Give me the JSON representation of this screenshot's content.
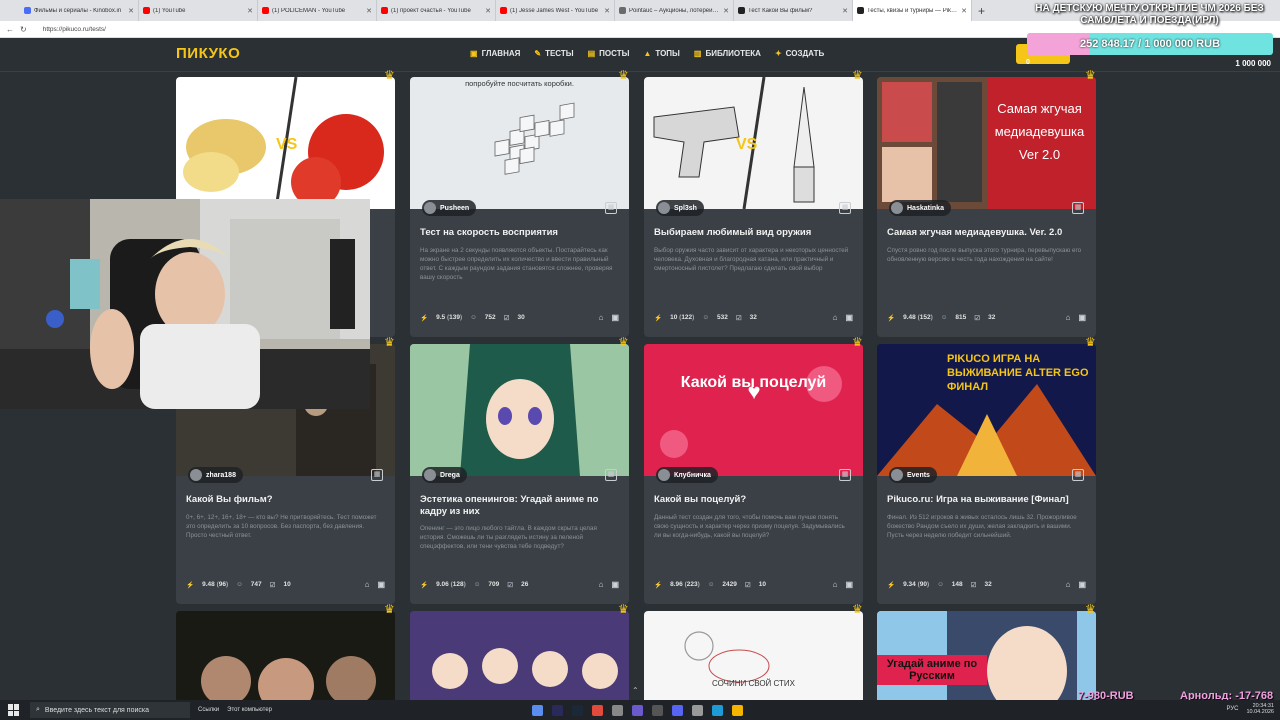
{
  "browser": {
    "tabs": [
      {
        "label": "Фильмы и сериалы - Kinobox.in",
        "color": "#4a6cf7",
        "active": false
      },
      {
        "label": "(1) YouTube",
        "color": "#ff0000",
        "active": false
      },
      {
        "label": "(1) POLICEMAN - YouTube",
        "color": "#ff0000",
        "active": false
      },
      {
        "label": "(1) проект счастья - YouTube",
        "color": "#ff0000",
        "active": false
      },
      {
        "label": "(1) Jesse James West - YouTube",
        "color": "#ff0000",
        "active": false
      },
      {
        "label": "Pointauc – Аукционы, лотереи и ...",
        "color": "#6b6b6b",
        "active": false
      },
      {
        "label": "Тест Какой Вы фильм?",
        "color": "#222222",
        "active": false
      },
      {
        "label": "Тесты, квизы и турниры — Piku...",
        "color": "#222222",
        "active": true
      }
    ],
    "new_tab": "+",
    "url": "https://pikuco.ru/tests/"
  },
  "site": {
    "logo": "ПИКУКО",
    "nav": [
      {
        "label": "ГЛАВНАЯ",
        "icon": "home-icon"
      },
      {
        "label": "ТЕСТЫ",
        "icon": "test-icon"
      },
      {
        "label": "ПОСТЫ",
        "icon": "posts-icon"
      },
      {
        "label": "ТОПЫ",
        "icon": "tops-icon"
      },
      {
        "label": "БИБЛИОТЕКА",
        "icon": "library-icon"
      },
      {
        "label": "СОЗДАТЬ",
        "icon": "create-icon"
      }
    ]
  },
  "donation": {
    "title": "НА ДЕТСКУЮ МЕЧТУ,ОТКРЫТИЕ ЧМ 2026 БЕЗ САМОЛЕТА И ПОЕЗДА(ИРЛ)",
    "progress_text": "252 848.17 / 1 000 000 RUB",
    "progress_fraction": 0.253,
    "min": "0",
    "max": "1 000 000"
  },
  "cards": [
    {
      "thumb": "potato-vs-tomato",
      "author": "",
      "title": "",
      "desc": "",
      "rating": "",
      "votes": "",
      "players": "",
      "questions": ""
    },
    {
      "thumb": "boxes",
      "thumb_caption": "попробуйте посчитать коробки.",
      "author": "Pusheen",
      "title": "Тест на скорость восприятия",
      "desc": "На экране на 2 секунды появляются объекты. Постарайтесь как можно быстрее определить их количество и ввести правильный ответ. С каждым раундом задания становятся сложнее, проверяя вашу скорость",
      "rating": "9.5",
      "votes": "139",
      "players": "752",
      "questions": "30"
    },
    {
      "thumb": "gun-vs-knife",
      "author": "Spl3sh",
      "title": "Выбираем любимый вид оружия",
      "desc": "Выбор оружия часто зависит от характера и некоторых ценностей человека. Духовная и благородная катана, или практичный и смертоносный пистолет? Предлагаю сделать свой выбор",
      "rating": "10",
      "votes": "122",
      "players": "532",
      "questions": "32"
    },
    {
      "thumb": "mediadevushka",
      "thumb_caption": "Самая жгучая медиадевушка Ver 2.0",
      "author": "Haskatinka",
      "title": "Самая жгучая медиадевушка. Ver. 2.0",
      "desc": "Спустя ровно год после выпуска этого турнира, перевыпускаю его обновленную версию в честь года нахождения на сайте!",
      "rating": "9.48",
      "votes": "152",
      "players": "815",
      "questions": "32"
    },
    {
      "thumb": "movie",
      "author": "zhara188",
      "title": "Какой Вы фильм?",
      "desc": "0+, 6+, 12+, 16+, 18+ — кто вы? Не притворяйтесь. Тест поможет это определить за 10 вопросов. Без паспорта, без давления. Просто честный ответ.",
      "rating": "9.48",
      "votes": "96",
      "players": "747",
      "questions": "10"
    },
    {
      "thumb": "anime-girl",
      "author": "Drega",
      "title": "Эстетика опенингов: Угадай аниме по кадру из них",
      "desc": "Опенинг — это лицо любого тайтла. В каждом скрыта целая история. Сможешь ли ты разглядеть истину за пеленой спецэффектов, или тени чувства тебе подведут?",
      "rating": "9.06",
      "votes": "128",
      "players": "709",
      "questions": "26"
    },
    {
      "thumb": "kiss",
      "thumb_caption": "Какой вы поцелуй",
      "author": "Клубничка",
      "title": "Какой вы поцелуй?",
      "desc": "Данный тест создан для того, чтобы помочь вам лучше понять свою сущность и характер через призму поцелуя. Задумывались ли вы когда-нибудь, какой вы поцелуй?",
      "rating": "8.96",
      "votes": "223",
      "players": "2429",
      "questions": "10"
    },
    {
      "thumb": "pikuco-final",
      "thumb_caption": "PIKUCO ИГРА НА ВЫЖИВАНИЕ ALTER EGO ФИНАЛ",
      "author": "Events",
      "title": "Pikuco.ru: Игра на выживание [Финал]",
      "desc": "Финал. Из 512 игроков в живых осталось лишь 32. Прожорливое божество Рандом съело их души, желая закладкить и вашими. Пусть через неделю победит сильнейший.",
      "rating": "9.34",
      "votes": "90",
      "players": "148",
      "questions": "32"
    },
    {
      "thumb": "actors",
      "author": "",
      "title": "",
      "desc": "",
      "rating": "",
      "votes": "",
      "players": "",
      "questions": ""
    },
    {
      "thumb": "anime-group",
      "author": "",
      "title": "",
      "desc": "",
      "rating": "",
      "votes": "",
      "players": "",
      "questions": ""
    },
    {
      "thumb": "sketch",
      "thumb_caption": "СОЧИНИ СВОЙ СТИХ",
      "author": "",
      "title": "",
      "desc": "",
      "rating": "",
      "votes": "",
      "players": "",
      "questions": ""
    },
    {
      "thumb": "anime-russian",
      "thumb_caption": "Угадай аниме по Русским",
      "author": "",
      "title": "",
      "desc": "",
      "rating": "",
      "votes": "",
      "players": "",
      "questions": ""
    }
  ],
  "taskbar": {
    "search_placeholder": "Введите здесь текст для поиска",
    "links": "Ссылки",
    "computer": "Этот компьютер",
    "lang": "РУС",
    "time": "20:34:31",
    "date": "10.04.2026"
  },
  "tickers": {
    "left": "7-980-RUB",
    "right": "Арнольд: -17-768"
  }
}
